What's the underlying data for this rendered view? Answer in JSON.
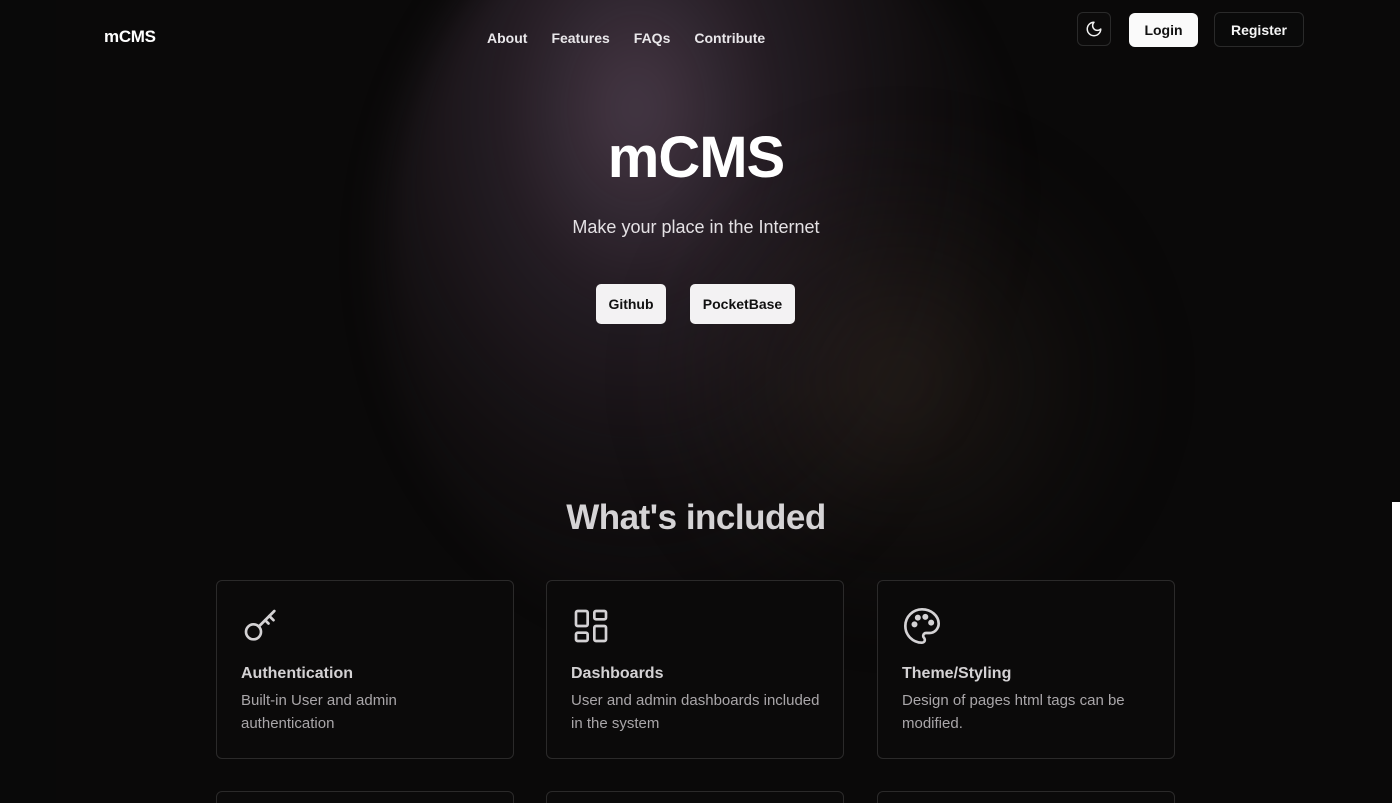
{
  "header": {
    "brand": "mCMS",
    "nav": [
      "About",
      "Features",
      "FAQs",
      "Contribute"
    ],
    "theme_icon": "moon-icon",
    "login_label": "Login",
    "register_label": "Register"
  },
  "hero": {
    "title": "mCMS",
    "subtitle": "Make your place in the Internet",
    "buttons": [
      "Github",
      "PocketBase"
    ]
  },
  "features": {
    "title": "What's included",
    "cards": [
      {
        "icon": "key-icon",
        "title": "Authentication",
        "description": "Built-in User and admin authentication"
      },
      {
        "icon": "dashboard-icon",
        "title": "Dashboards",
        "description": "User and admin dashboards included in the system"
      },
      {
        "icon": "palette-icon",
        "title": "Theme/Styling",
        "description": "Design of pages html tags can be modified."
      }
    ]
  },
  "colors": {
    "background": "#0a0909",
    "accent_glow": "#785f78",
    "button_light": "#fafafa"
  }
}
